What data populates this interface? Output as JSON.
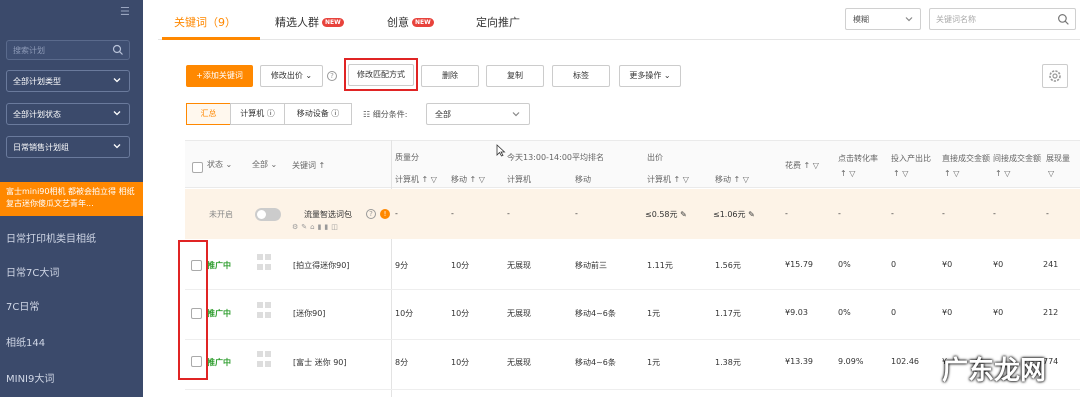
{
  "sidebar": {
    "search_placeholder": "搜索计划",
    "plan_type": "全部计划类型",
    "plan_status": "全部计划状态",
    "plan_group": "日常销售计划组",
    "active_item": "富士mini90相机 都被会拍立得 相纸 复古迷你傻瓜文艺青年...",
    "items": [
      "日常打印机类目相纸",
      "日常7C大词",
      "7C日常",
      "相纸144",
      "MINI9大词"
    ]
  },
  "tabs": [
    {
      "label": "关键词（9）",
      "active": true
    },
    {
      "label": "精选人群",
      "badge": "NEW"
    },
    {
      "label": "创意",
      "badge": "NEW"
    },
    {
      "label": "定向推广"
    }
  ],
  "search": {
    "match_mode": "模糊",
    "placeholder": "关键词名称"
  },
  "toolbar": {
    "add_keyword": "+添加关键词",
    "modify_bid": "修改出价",
    "modify_match": "修改匹配方式",
    "delete": "删除",
    "copy": "复制",
    "tag": "标签",
    "more": "更多操作"
  },
  "view": {
    "segments": [
      "汇总",
      "计算机",
      "移动设备"
    ],
    "filter_label": "细分条件:",
    "filter_value": "全部"
  },
  "table": {
    "headers": {
      "status": "状态",
      "all": "全部",
      "keyword": "关键词",
      "quality": "质量分",
      "rank_group": "今天13:00-14:00平均排名",
      "bid": "出价",
      "cost": "花费",
      "cvr": "点击转化率",
      "roi": "投入产出比",
      "direct_gmv": "直接成交金额",
      "indirect_gmv": "间接成交金额",
      "impressions": "展现量",
      "pc": "计算机",
      "mobile": "移动"
    },
    "summary": {
      "status": "未开启",
      "keyword": "流量智选词包",
      "quality_pc": "-",
      "quality_mobile": "-",
      "rank_pc": "-",
      "rank_mobile": "-",
      "bid_pc": "≤0.58元",
      "bid_mobile": "≤1.06元",
      "cost": "-",
      "cvr": "-",
      "roi": "-",
      "direct": "-",
      "indirect": "-",
      "impressions": "-"
    },
    "rows": [
      {
        "status": "推广中",
        "keyword": "[拍立得迷你90]",
        "q_pc": "9分",
        "q_mobile": "10分",
        "r_pc": "无展现",
        "r_mobile": "移动前三",
        "bid_pc": "1.11元",
        "bid_mobile": "1.56元",
        "cost": "¥15.79",
        "cvr": "0%",
        "roi": "0",
        "direct": "¥0",
        "indirect": "¥0",
        "impressions": "241"
      },
      {
        "status": "推广中",
        "keyword": "[迷你90]",
        "q_pc": "10分",
        "q_mobile": "10分",
        "r_pc": "无展现",
        "r_mobile": "移动4~6条",
        "bid_pc": "1元",
        "bid_mobile": "1.17元",
        "cost": "¥9.03",
        "cvr": "0%",
        "roi": "0",
        "direct": "¥0",
        "indirect": "¥0",
        "impressions": "212"
      },
      {
        "status": "推广中",
        "keyword": "[富士 迷你 90]",
        "q_pc": "8分",
        "q_mobile": "10分",
        "r_pc": "无展现",
        "r_mobile": "移动4~6条",
        "bid_pc": "1元",
        "bid_mobile": "1.38元",
        "cost": "¥13.39",
        "cvr": "9.09%",
        "roi": "102.46",
        "direct": "¥",
        "indirect": "",
        "impressions": "774"
      }
    ]
  },
  "watermark": "广东龙网"
}
